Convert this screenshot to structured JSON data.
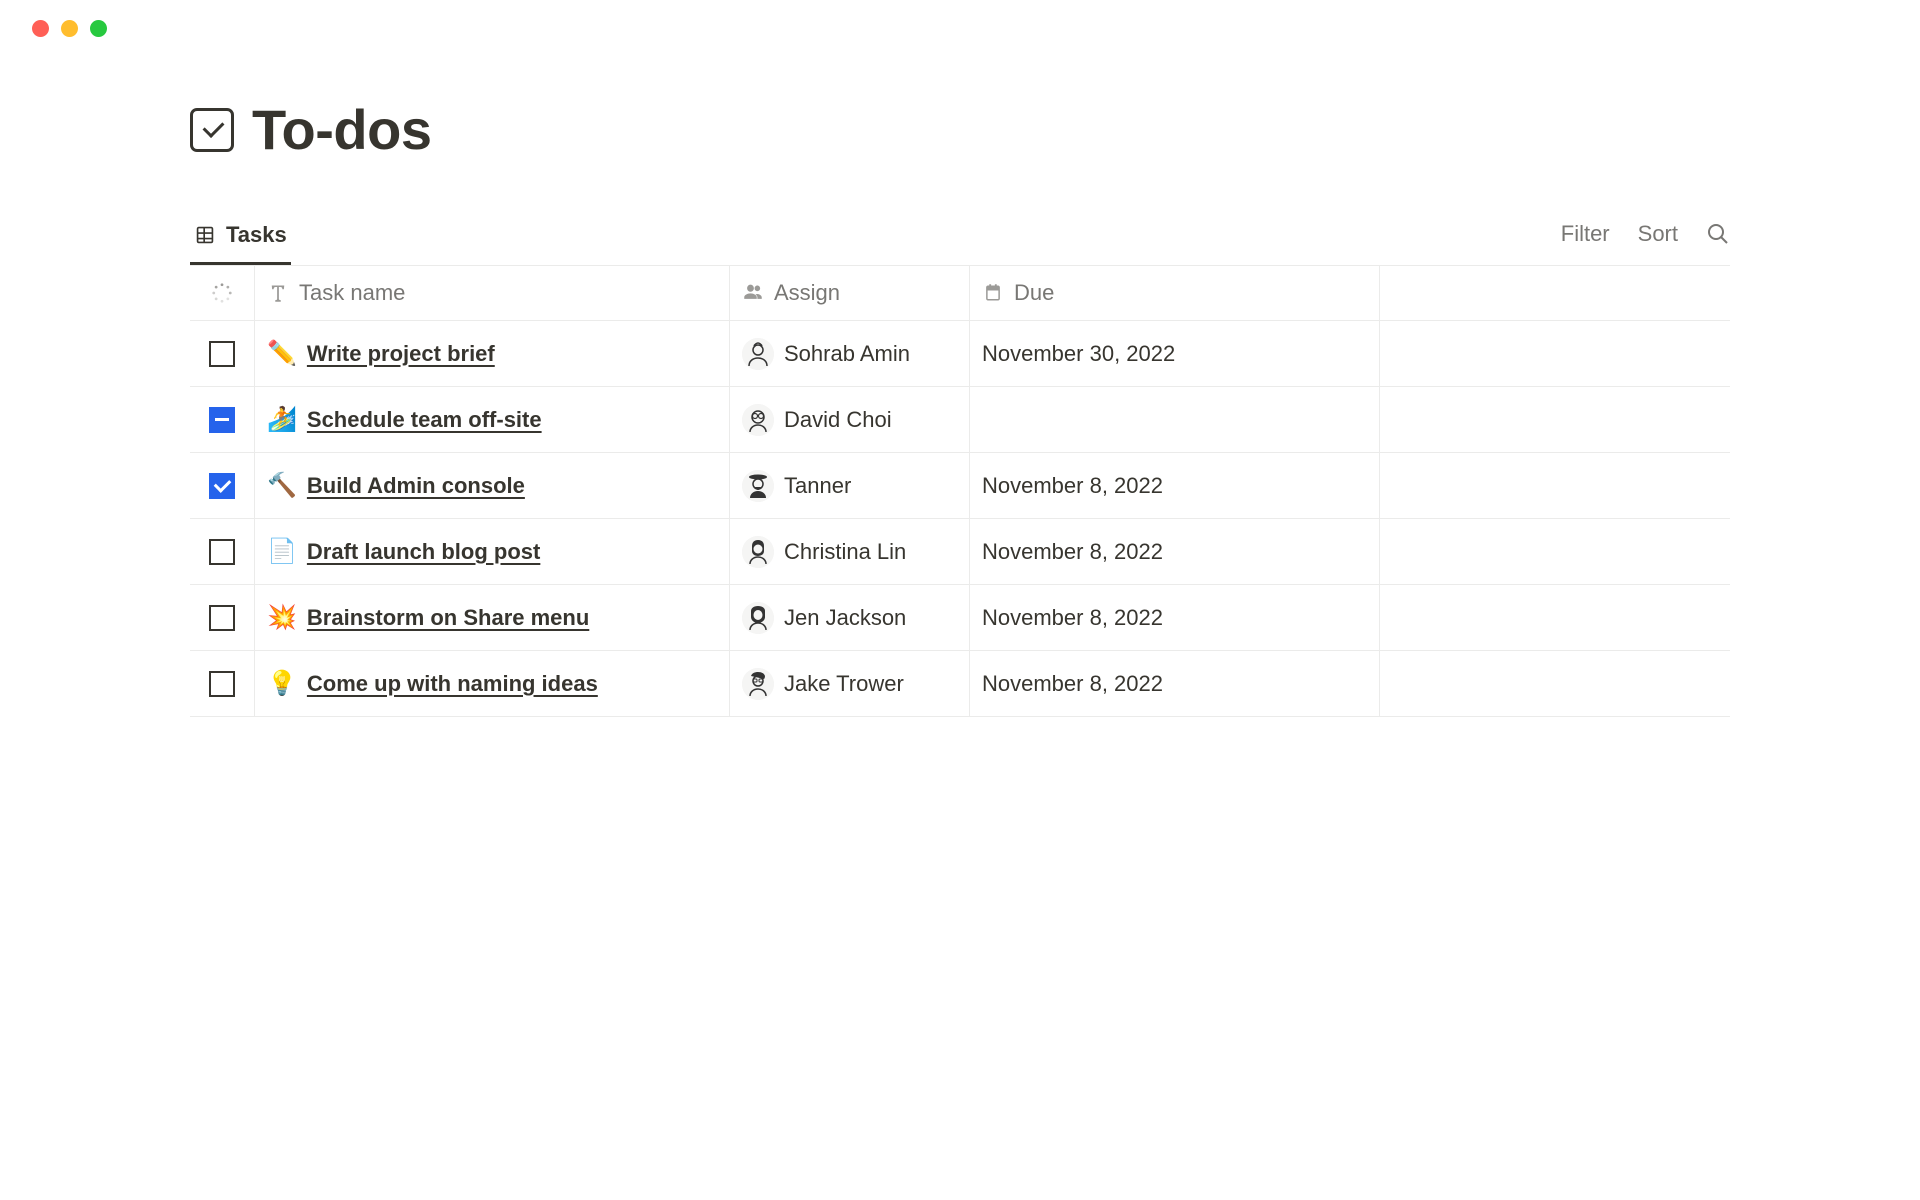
{
  "page": {
    "title": "To-dos"
  },
  "tabs": {
    "active": "Tasks"
  },
  "toolbar": {
    "filter": "Filter",
    "sort": "Sort"
  },
  "columns": {
    "name": "Task name",
    "assign": "Assign",
    "due": "Due"
  },
  "tasks": [
    {
      "checkState": "unchecked",
      "emoji": "✏️",
      "name": "Write project brief",
      "assign": "Sohrab Amin",
      "due": "November 30, 2022"
    },
    {
      "checkState": "indeterminate",
      "emoji": "🏄",
      "name": "Schedule team off-site",
      "assign": "David Choi",
      "due": ""
    },
    {
      "checkState": "checked",
      "emoji": "🔨",
      "name": "Build Admin console",
      "assign": "Tanner",
      "due": "November 8, 2022"
    },
    {
      "checkState": "unchecked",
      "emoji": "📄",
      "name": "Draft launch blog post",
      "assign": "Christina Lin",
      "due": "November 8, 2022"
    },
    {
      "checkState": "unchecked",
      "emoji": "💥",
      "name": "Brainstorm on Share menu",
      "assign": "Jen Jackson",
      "due": "November 8, 2022"
    },
    {
      "checkState": "unchecked",
      "emoji": "💡",
      "name": "Come up with naming ideas",
      "assign": "Jake Trower",
      "due": "November 8, 2022"
    }
  ]
}
